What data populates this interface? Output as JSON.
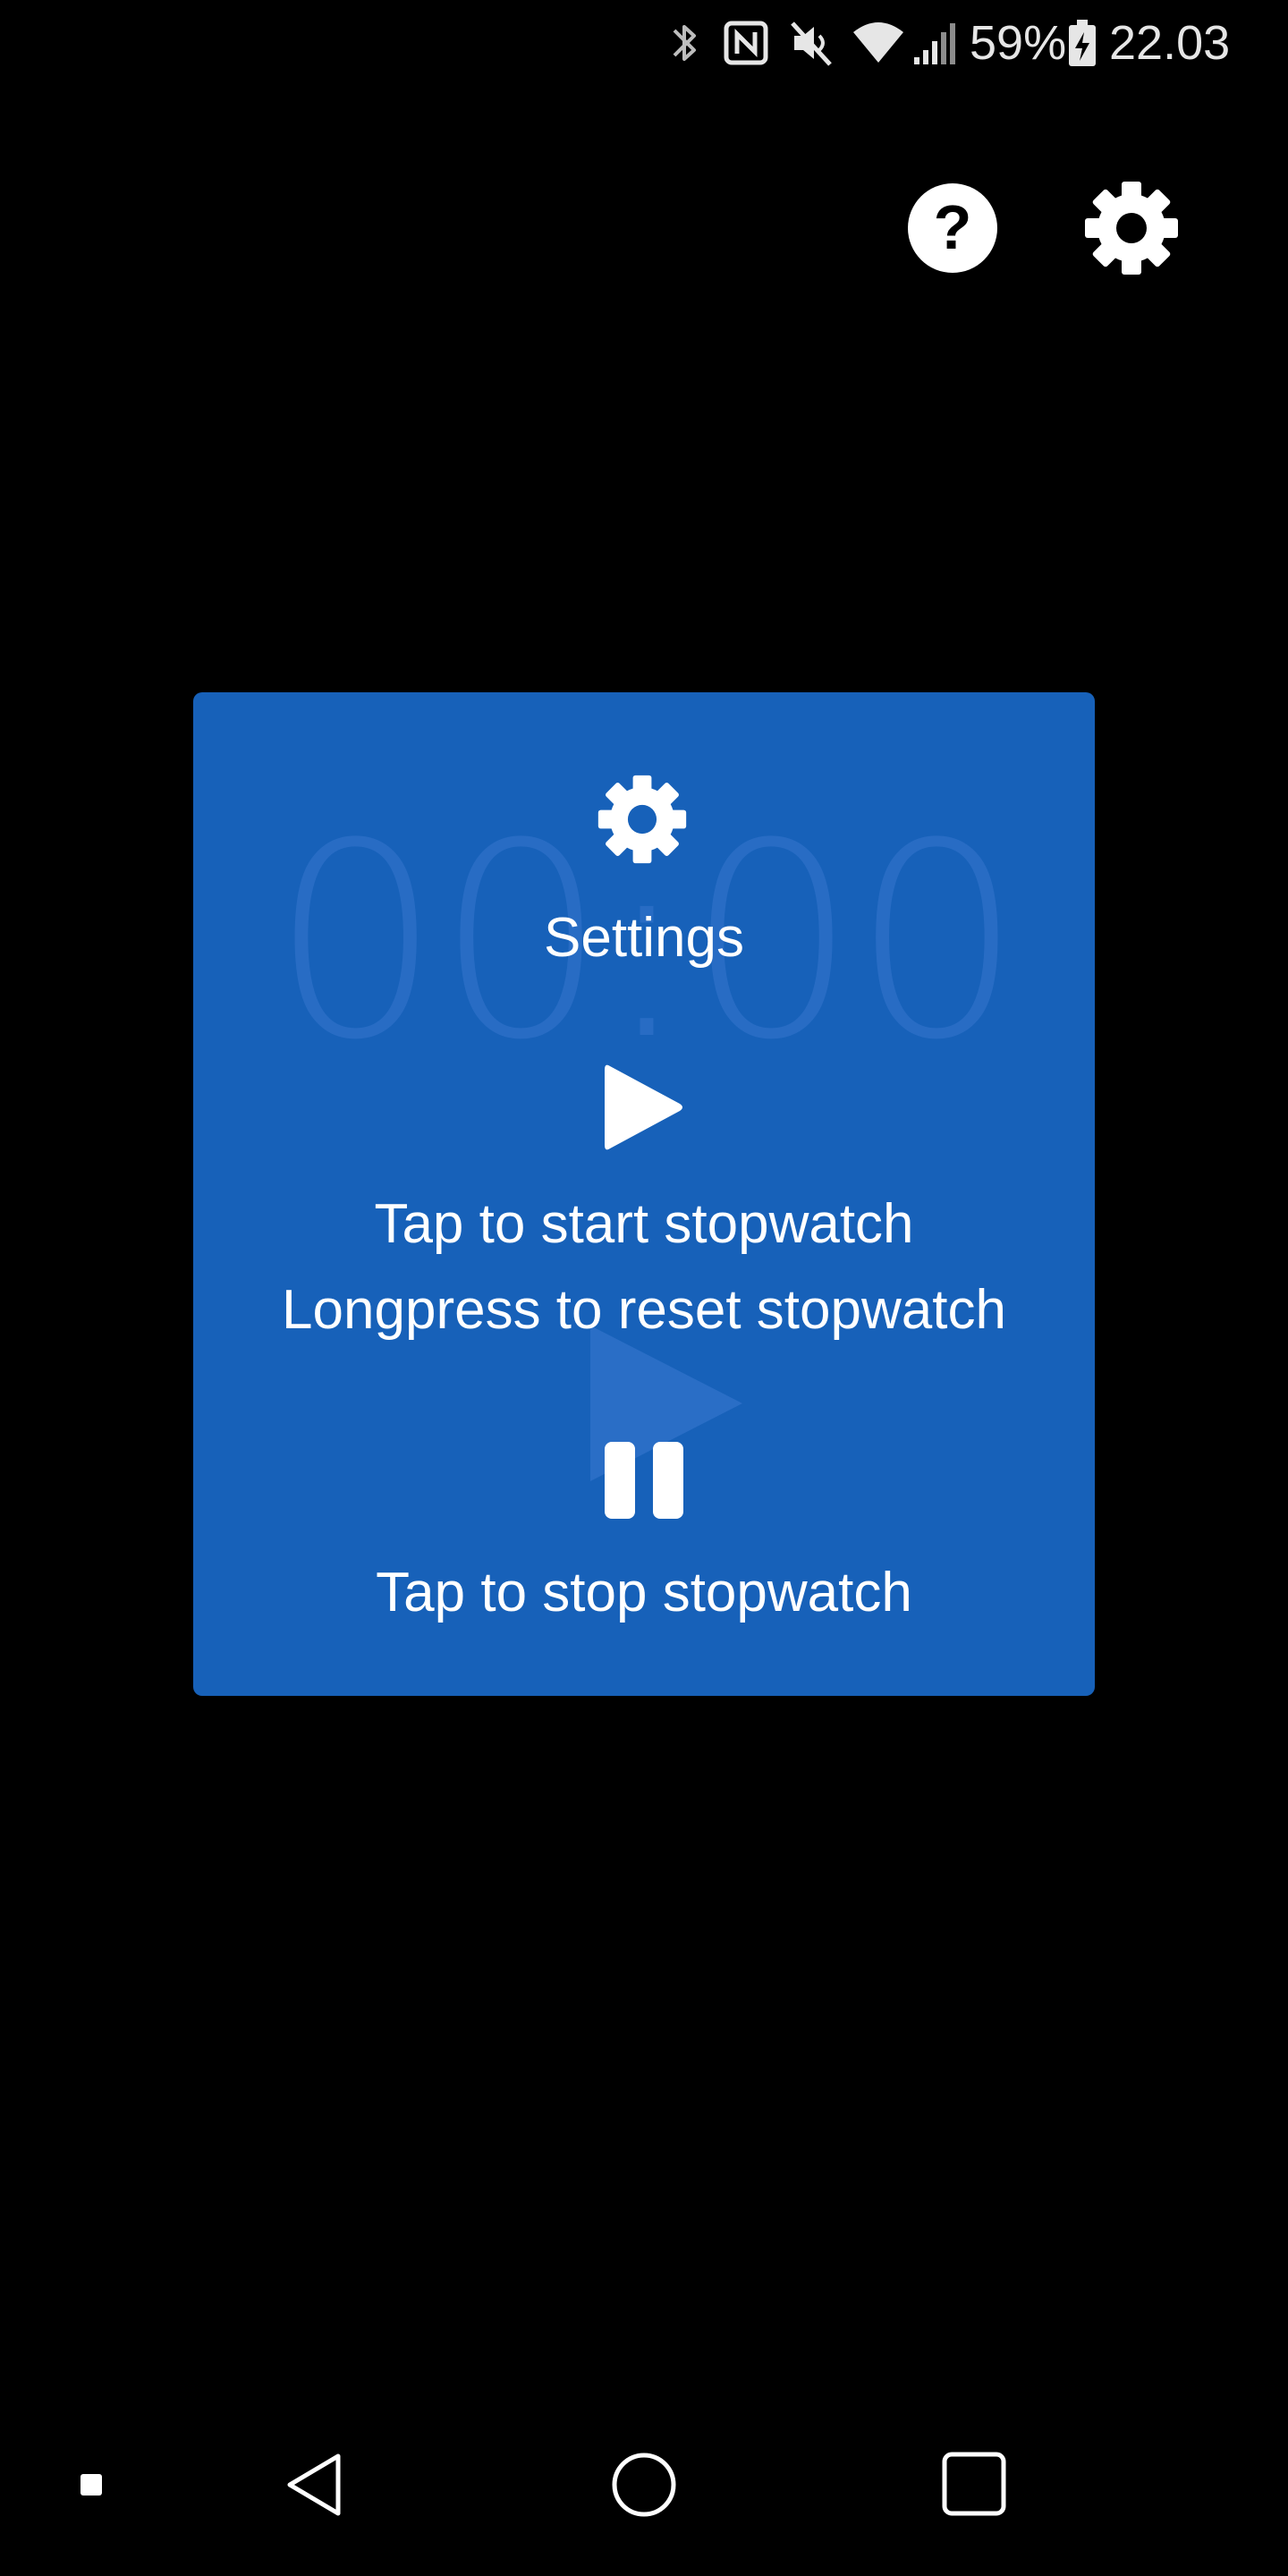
{
  "status_bar": {
    "battery_percent": "59%",
    "time": "22.03",
    "icons": [
      "bluetooth-icon",
      "nfc-icon",
      "mute-icon",
      "wifi-icon",
      "signal-icon",
      "battery-charging-icon"
    ]
  },
  "top_actions": {
    "help_icon": "help-icon",
    "settings_icon": "gear-icon"
  },
  "card": {
    "background_color": "#1761b9",
    "watermark_time": "00:00",
    "settings_label": "Settings",
    "start_label": "Tap to start stopwatch",
    "reset_label": "Longpress to reset stopwatch",
    "stop_label": "Tap to stop stopwatch"
  },
  "nav_bar": {
    "icons": [
      "dot-icon",
      "back-icon",
      "home-icon",
      "recents-icon"
    ]
  }
}
